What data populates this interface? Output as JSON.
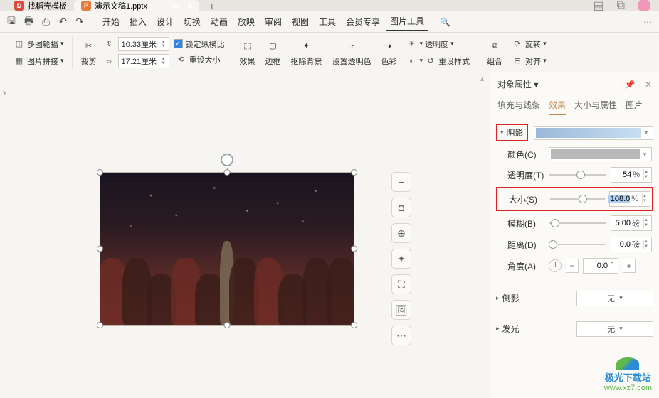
{
  "titlebar": {
    "tab1_icon": "D",
    "tab1_text": "找稻壳模板",
    "tab2_icon": "P",
    "tab2_text": "演示文稿1.pptx",
    "add_tab": "+"
  },
  "ribbon": {
    "tabs": [
      "开始",
      "插入",
      "设计",
      "切换",
      "动画",
      "放映",
      "审阅",
      "视图",
      "工具",
      "会员专享",
      "图片工具"
    ],
    "active_index": 10
  },
  "toolbar": {
    "multi_crop": "多图轮播",
    "img_join": "图片拼接",
    "crop": "裁剪",
    "h_label": "10.33厘米",
    "w_label": "17.21厘米",
    "lock_ratio": "锁定纵横比",
    "reset_size": "重设大小",
    "effect": "效果",
    "border": "边框",
    "remove_bg": "抠除背景",
    "set_trans": "设置透明色",
    "color": "色彩",
    "opacity": "透明度",
    "reset_style": "重设样式",
    "group": "组合",
    "rotate": "旋转",
    "align": "对齐"
  },
  "panel": {
    "title": "对象属性",
    "tabs": [
      "填充与线条",
      "效果",
      "大小与属性",
      "图片"
    ],
    "active": 1,
    "shadow": {
      "label": "阴影",
      "color_label": "颜色(C)",
      "opacity_label": "透明度(T)",
      "opacity_val": "54",
      "opacity_unit": "%",
      "size_label": "大小(S)",
      "size_val": "108.0",
      "size_unit": "%",
      "blur_label": "模糊(B)",
      "blur_val": "5.00",
      "blur_unit": "磅",
      "dist_label": "距离(D)",
      "dist_val": "0.0",
      "dist_unit": "磅",
      "angle_label": "角度(A)",
      "angle_val": "0.0",
      "angle_unit": "°"
    },
    "reflection": {
      "label": "倒影",
      "value": "无"
    },
    "glow": {
      "label": "发光",
      "value": "无"
    }
  },
  "watermark": {
    "line1": "极光下载站",
    "line2": "www.xz7.com"
  }
}
